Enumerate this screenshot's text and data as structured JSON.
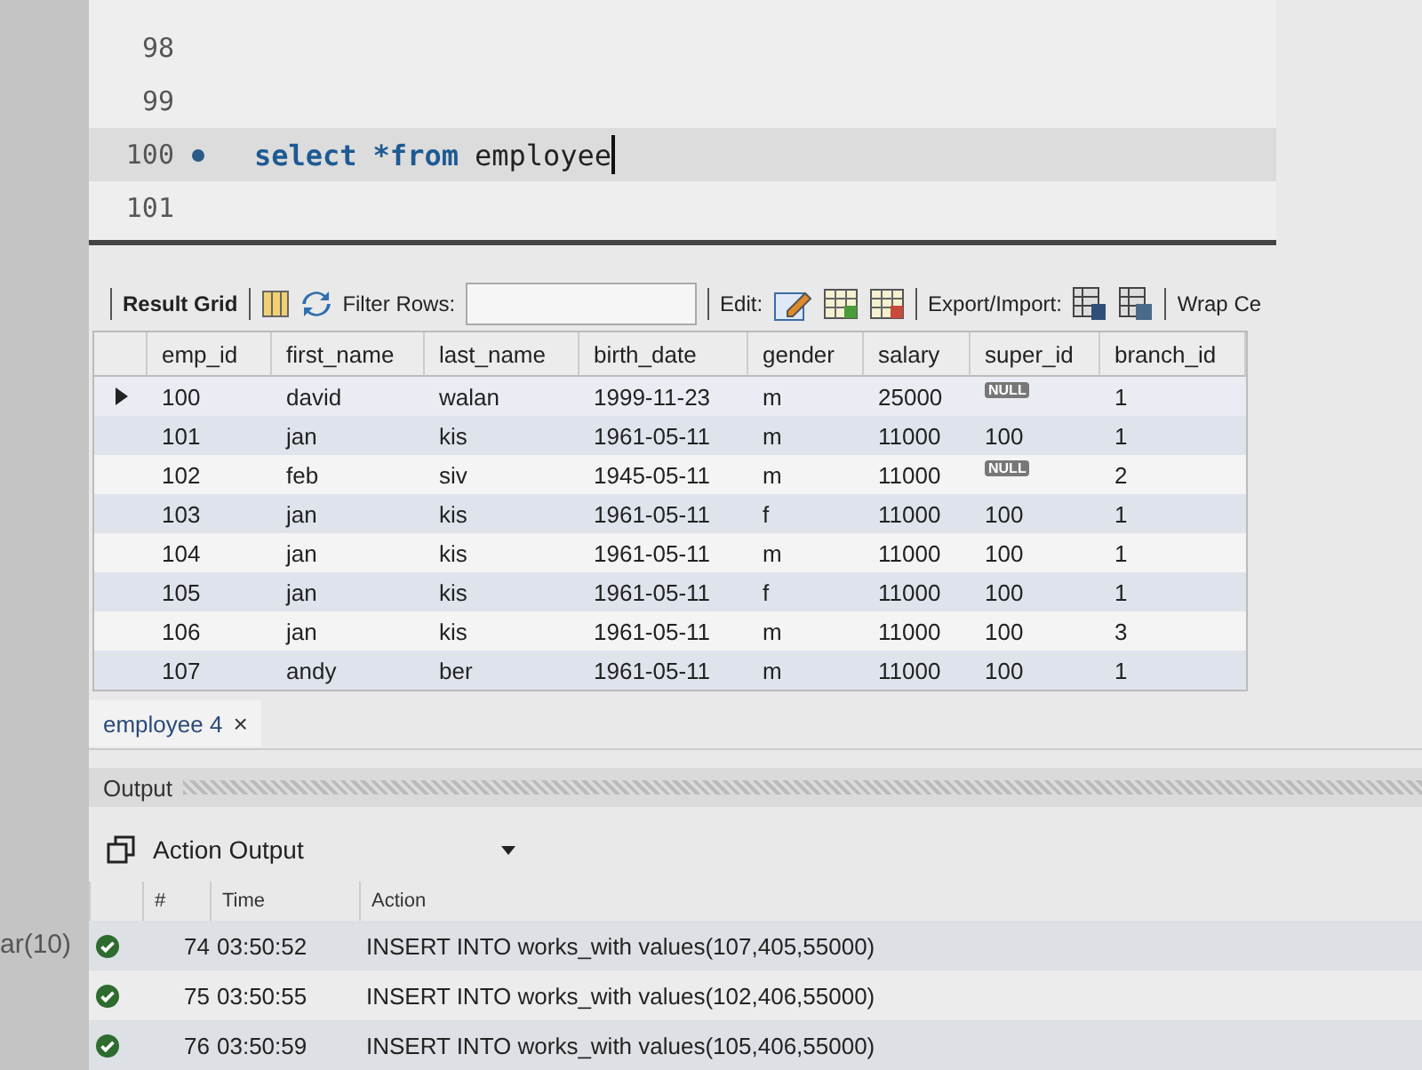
{
  "editor": {
    "lines": [
      {
        "number": "98",
        "current": false
      },
      {
        "number": "99",
        "current": false
      },
      {
        "number": "100",
        "current": true,
        "tokens": [
          {
            "text": "select",
            "kind": "keyword"
          },
          {
            "text": "*from",
            "kind": "keyword"
          },
          {
            "text": "employee",
            "kind": "plain"
          }
        ]
      },
      {
        "number": "101",
        "current": false
      }
    ]
  },
  "side_fragment": "ar(10)",
  "toolbar": {
    "result_grid": "Result Grid",
    "filter_label": "Filter Rows:",
    "edit_label": "Edit:",
    "export_label": "Export/Import:",
    "wrap_label": "Wrap Ce"
  },
  "grid": {
    "columns": [
      "emp_id",
      "first_name",
      "last_name",
      "birth_date",
      "gender",
      "salary",
      "super_id",
      "branch_id"
    ],
    "rows": [
      {
        "selected": true,
        "cells": [
          "100",
          "david",
          "walan",
          "1999-11-23",
          "m",
          "25000",
          {
            "text": "NULL",
            "kind": "null"
          },
          "1"
        ]
      },
      {
        "selected": false,
        "cells": [
          "101",
          "jan",
          "kis",
          "1961-05-11",
          "m",
          "11000",
          "100",
          "1"
        ]
      },
      {
        "selected": false,
        "cells": [
          "102",
          "feb",
          "siv",
          "1945-05-11",
          "m",
          "11000",
          {
            "text": "NULL",
            "kind": "null"
          },
          "2"
        ]
      },
      {
        "selected": false,
        "cells": [
          "103",
          "jan",
          "kis",
          "1961-05-11",
          "f",
          "11000",
          "100",
          "1"
        ]
      },
      {
        "selected": false,
        "cells": [
          "104",
          "jan",
          "kis",
          "1961-05-11",
          "m",
          "11000",
          "100",
          "1"
        ]
      },
      {
        "selected": false,
        "cells": [
          "105",
          "jan",
          "kis",
          "1961-05-11",
          "f",
          "11000",
          "100",
          "1"
        ]
      },
      {
        "selected": false,
        "cells": [
          "106",
          "jan",
          "kis",
          "1961-05-11",
          "m",
          "11000",
          "100",
          "3"
        ]
      },
      {
        "selected": false,
        "cells": [
          "107",
          "andy",
          "ber",
          "1961-05-11",
          "m",
          "11000",
          "100",
          "1"
        ]
      }
    ]
  },
  "result_tabs": [
    {
      "label": "employee 4",
      "close": "×",
      "selected": true
    }
  ],
  "output": {
    "title": "Output",
    "selector": "Action Output",
    "columns": [
      "#",
      "Time",
      "Action"
    ],
    "rows": [
      {
        "succeeded": true,
        "number": "74",
        "time": "03:50:52",
        "action": "INSERT INTO works_with values(107,405,55000)"
      },
      {
        "succeeded": true,
        "number": "75",
        "time": "03:50:55",
        "action": "INSERT INTO works_with values(102,406,55000)"
      },
      {
        "succeeded": true,
        "number": "76",
        "time": "03:50:59",
        "action": "INSERT INTO works_with values(105,406,55000)"
      }
    ]
  }
}
